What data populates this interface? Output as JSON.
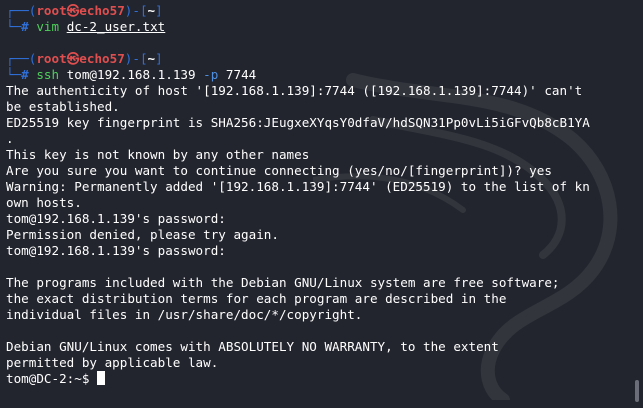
{
  "prompt1": {
    "frame_top": "┌──(",
    "user": "root",
    "skull": "㉿",
    "host": "echo57",
    "sep": ")-[",
    "cwd": "~",
    "close": "]",
    "frame_bottom": "└─",
    "hash": "# ",
    "command": "vim",
    "argument": "dc-2_user.txt"
  },
  "prompt2": {
    "frame_top": "┌──(",
    "user": "root",
    "skull": "㉿",
    "host": "echo57",
    "sep": ")-[",
    "cwd": "~",
    "close": "]",
    "frame_bottom": "└─",
    "hash": "# ",
    "command": "ssh",
    "target": " tom@192.168.1.139 ",
    "flag": "-p",
    "port": " 7744"
  },
  "output": [
    "The authenticity of host '[192.168.1.139]:7744 ([192.168.1.139]:7744)' can't",
    "be established.",
    "ED25519 key fingerprint is SHA256:JEugxeXYqsY0dfaV/hdSQN31Pp0vLi5iGFvQb8cB1YA",
    ".",
    "This key is not known by any other names",
    "Are you sure you want to continue connecting (yes/no/[fingerprint])? yes",
    "Warning: Permanently added '[192.168.1.139]:7744' (ED25519) to the list of kn",
    "own hosts.",
    "tom@192.168.1.139's password: ",
    "Permission denied, please try again.",
    "tom@192.168.1.139's password: ",
    "",
    "The programs included with the Debian GNU/Linux system are free software;",
    "the exact distribution terms for each program are described in the",
    "individual files in /usr/share/doc/*/copyright.",
    "",
    "Debian GNU/Linux comes with ABSOLUTELY NO WARRANTY, to the extent",
    "permitted by applicable law."
  ],
  "final_prompt": "tom@DC-2:~$ ",
  "colors": {
    "background": "#23252e",
    "frame": "#2f6fd8",
    "user_host": "#e04f4f",
    "command": "#4fcf5c",
    "text": "#ffffff"
  }
}
